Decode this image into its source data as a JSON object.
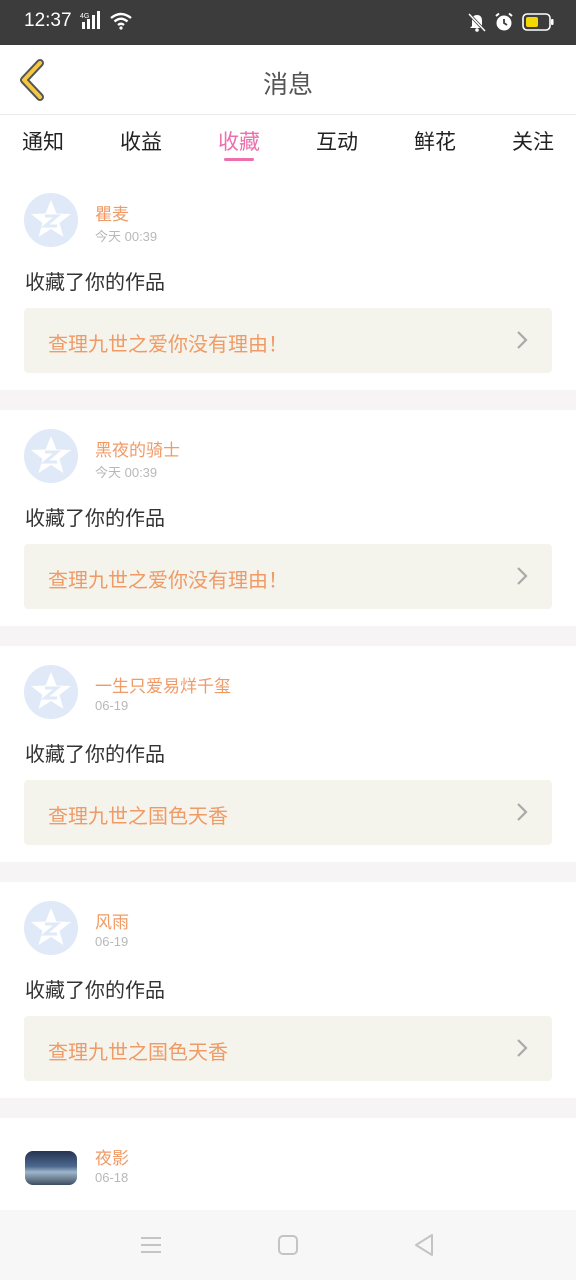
{
  "status_bar": {
    "time": "12:37",
    "network": "4G",
    "icons": [
      "signal-icon",
      "wifi-icon",
      "mute-icon",
      "alarm-icon",
      "battery-icon"
    ]
  },
  "header": {
    "title": "消息",
    "back_icon": "chevron-left-icon"
  },
  "tabs": [
    {
      "label": "通知",
      "active": false
    },
    {
      "label": "收益",
      "active": false
    },
    {
      "label": "收藏",
      "active": true
    },
    {
      "label": "互动",
      "active": false
    },
    {
      "label": "鲜花",
      "active": false
    },
    {
      "label": "关注",
      "active": false
    }
  ],
  "messages": [
    {
      "username": "瞿麦",
      "time": "今天 00:39",
      "action": "收藏了你的作品",
      "work": "查理九世之爱你没有理由！"
    },
    {
      "username": "黑夜的骑士",
      "time": "今天 00:39",
      "action": "收藏了你的作品",
      "work": "查理九世之爱你没有理由！"
    },
    {
      "username": "一生只爱易烊千玺",
      "time": "06-19",
      "action": "收藏了你的作品",
      "work": "查理九世之国色天香"
    },
    {
      "username": "风雨",
      "time": "06-19",
      "action": "收藏了你的作品",
      "work": "查理九世之国色天香"
    },
    {
      "username": "夜影",
      "time": "06-18"
    }
  ],
  "colors": {
    "accent": "#ec6fae",
    "username": "#f09a66",
    "back_arrow": "#f5c842",
    "card_bg": "#f4f4ec"
  },
  "nav_bar": {
    "icons": [
      "menu-icon",
      "home-icon",
      "back-icon"
    ]
  }
}
